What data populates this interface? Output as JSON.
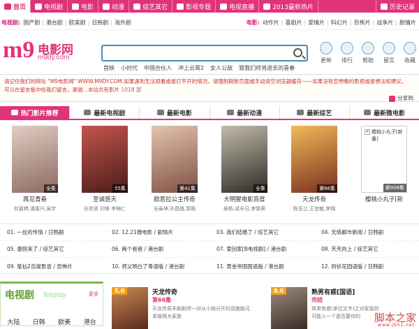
{
  "topnav": {
    "items": [
      {
        "label": "首页",
        "active": true
      },
      {
        "label": "电视剧"
      },
      {
        "label": "电影"
      },
      {
        "label": "动漫"
      },
      {
        "label": "综艺其它"
      },
      {
        "label": "影视专题"
      },
      {
        "label": "电视直播"
      },
      {
        "label": "2013最新热片"
      }
    ],
    "history": "历史记录"
  },
  "categories": {
    "tv_label": "电视剧:",
    "tv": [
      "国产剧",
      "港台剧",
      "欧美剧",
      "日韩剧",
      "海外剧"
    ],
    "movie_label": "电影:",
    "movie": [
      "动作片",
      "喜剧片",
      "爱情片",
      "科幻片",
      "恐怖片",
      "战争片",
      "剧情片"
    ]
  },
  "logo": {
    "mark": "m9",
    "name": "电影网",
    "domain": "m9dy.com"
  },
  "search": {
    "placeholder": ""
  },
  "hot_keywords": [
    "首映",
    "小时代",
    "中国合伙人",
    "冲上云霄2",
    "女人公敌",
    "致我们终将逝去的青春"
  ],
  "tools": [
    {
      "label": "更新",
      "icon": "update-icon"
    },
    {
      "label": "排行",
      "icon": "rank-icon"
    },
    {
      "label": "帮助",
      "icon": "help-icon"
    },
    {
      "label": "留言",
      "icon": "message-icon"
    },
    {
      "label": "收藏",
      "icon": "favorite-icon"
    }
  ],
  "notice": {
    "line1": "请记住我们的网址 \"M9电影网\"  WWW.M9DY.COM,如果遇到无法观看或者打不开的情况，请强制刷新页面或手动清空浏览器缓存——如果没有您想看的影视或者想法和建议，",
    "line2": "可以在留言板中给我们留言，谢谢…本站共有影片",
    "count": "1018 部",
    "share": "分享到:"
  },
  "tabs": [
    {
      "label": "热门影片推荐",
      "active": true
    },
    {
      "label": "最新电视剧"
    },
    {
      "label": "最新电影"
    },
    {
      "label": "最新动漫"
    },
    {
      "label": "最新综艺"
    },
    {
      "label": "最新微电影"
    }
  ],
  "films": [
    {
      "name": "再见青春",
      "actors": "何嘉婷,潘嘉兴,吴宇",
      "badge": "全集",
      "colors": [
        "#d9c0b3",
        "#8a6a60"
      ]
    },
    {
      "name": "至诚感天",
      "actors": "孙世贤 刘锋 李梅仁",
      "badge": "55集",
      "colors": [
        "#b2413a",
        "#4a1c1a"
      ]
    },
    {
      "name": "欧若拉公主传奇",
      "actors": "全泰坤,孙昌植,郭皓",
      "badge": "第41集",
      "colors": [
        "#d6b098",
        "#7f5044"
      ]
    },
    {
      "name": "大明猩电影百度",
      "actors": "侯杨,成丰日,李致荣",
      "badge": "全集",
      "colors": [
        "#a9a494",
        "#2f2a26"
      ]
    },
    {
      "name": "天龙传奇",
      "actors": "陈亚兰,王宜敏,李翔",
      "badge": "第66集",
      "colors": [
        "#e9a53a",
        "#7a2f1e"
      ]
    },
    {
      "name": "樱桃小丸子[新",
      "actors": "",
      "badge": "第908集",
      "broken": true,
      "alt": "樱桃小丸子[新番]"
    }
  ],
  "list": [
    [
      "01. 一丝的传情 / 日韩剧",
      "02. 12.21微电影 / 剧情片",
      "03. 我们结婚了 / 综艺其它",
      "04. 无情都市新闻 / 日韩剧"
    ],
    [
      "05. 康熙来了 / 综艺其它",
      "06. 两个爸爸 / 港台剧",
      "07. 爱回家[B电视剧] / 港台剧",
      "08. 天天向上 / 综艺其它"
    ],
    [
      "09. 笔仙2百度影音 / 恐怖片",
      "10. 师父明白了粤语版 / 港台剧",
      "11. 黄金帝国国语版 / 港台剧",
      "12. 刑侦花园语版 / 日韩剧"
    ]
  ],
  "tvbox": {
    "title": "电视剧",
    "sub": "Teleplay",
    "more": "更多",
    "regions": [
      "大陆",
      "日韩",
      "欧美",
      "港台"
    ]
  },
  "cards": [
    {
      "score": "5.0",
      "title": "天龙传奇",
      "episode": "第66集",
      "desc": "天龙传奇丰剧剧述一对从小就分开的双胞胎兄弟被两大家族"
    },
    {
      "score": "8.0",
      "title": "熟男有惑[国语]",
      "episode": "完结",
      "desc": "熟男有惑(单位文字)之对家庭的可能入一个是否要你的"
    }
  ],
  "watermark": {
    "cn": "脚本之家",
    "en": "www.jb51.net"
  }
}
